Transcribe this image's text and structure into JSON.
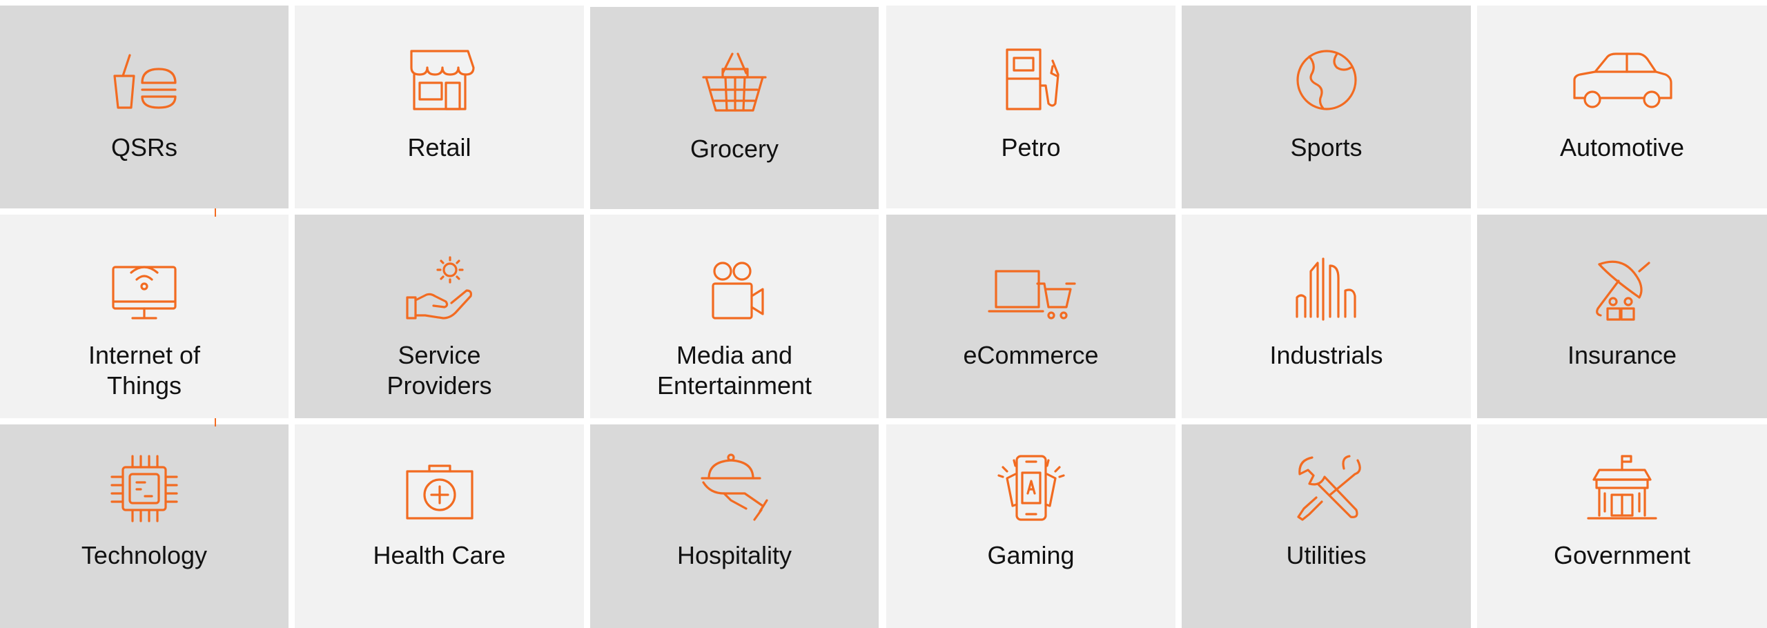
{
  "accent_color": "#f26b21",
  "tile_colors": {
    "dark": "#d9d9d9",
    "light": "#f2f2f2"
  },
  "industries": [
    {
      "label": "QSRs",
      "icon": "fast-food-icon"
    },
    {
      "label": "Retail",
      "icon": "storefront-icon"
    },
    {
      "label": "Grocery",
      "icon": "shopping-basket-icon"
    },
    {
      "label": "Petro",
      "icon": "fuel-pump-icon"
    },
    {
      "label": "Sports",
      "icon": "globe-ball-icon"
    },
    {
      "label": "Automotive",
      "icon": "car-icon"
    },
    {
      "label": "Internet of\nThings",
      "icon": "wifi-monitor-icon"
    },
    {
      "label": "Service\nProviders",
      "icon": "hand-gear-icon"
    },
    {
      "label": "Media and\nEntertainment",
      "icon": "video-camera-icon"
    },
    {
      "label": "eCommerce",
      "icon": "laptop-cart-icon"
    },
    {
      "label": "Industrials",
      "icon": "industrial-buildings-icon"
    },
    {
      "label": "Insurance",
      "icon": "umbrella-house-icon"
    },
    {
      "label": "Technology",
      "icon": "microchip-icon"
    },
    {
      "label": "Health Care",
      "icon": "medical-kit-icon"
    },
    {
      "label": "Hospitality",
      "icon": "cloche-tray-icon"
    },
    {
      "label": "Gaming",
      "icon": "phone-cards-icon"
    },
    {
      "label": "Utilities",
      "icon": "wrench-screwdriver-icon"
    },
    {
      "label": "Government",
      "icon": "government-building-icon"
    }
  ]
}
